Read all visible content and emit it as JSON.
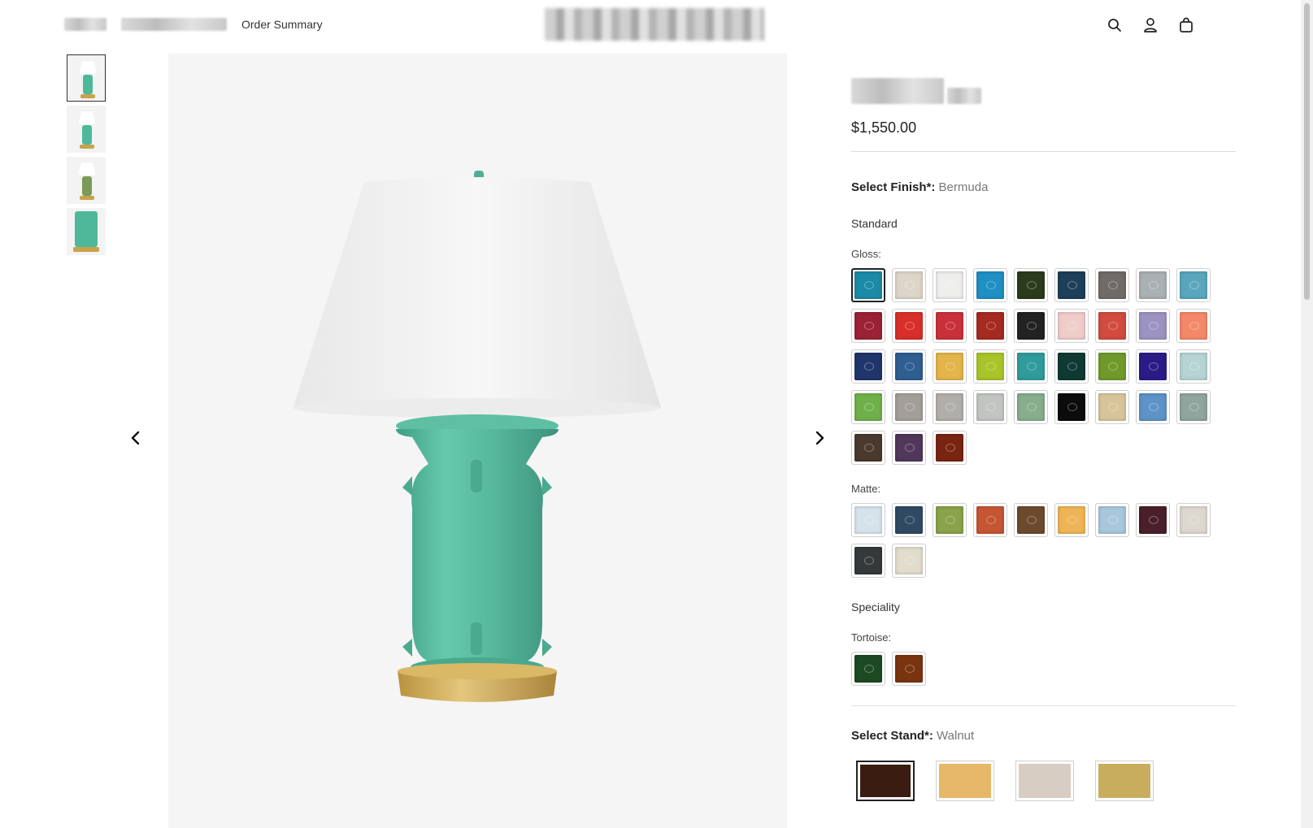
{
  "header": {
    "breadcrumb_current": "Order Summary",
    "icons": [
      "search-icon",
      "account-icon",
      "bag-icon"
    ]
  },
  "gallery": {
    "thumbnails": 4,
    "prev_icon": "chevron-left-icon",
    "next_icon": "chevron-right-icon"
  },
  "product": {
    "price": "$1,550.00",
    "finish": {
      "label": "Select Finish",
      "required_mark": "*:",
      "selected_value": "Bermuda",
      "standard_title": "Standard",
      "gloss_title": "Gloss:",
      "gloss_colors": [
        "#1b8aa6",
        "#ddd6c8",
        "#eeeeec",
        "#1f8fc4",
        "#2c3b1c",
        "#1d3f5a",
        "#6f6b69",
        "#a9b1b3",
        "#5aa6bd",
        "#9b2233",
        "#d92f2a",
        "#c9313a",
        "#a52a20",
        "#222222",
        "#efcdc8",
        "#d14b3e",
        "#9c93c2",
        "#f4896a",
        "#1f356b",
        "#2f5e91",
        "#e3b54a",
        "#a9c42a",
        "#2f9b9b",
        "#0f3a33",
        "#6f9a2a",
        "#2a1c86",
        "#b5d4d3",
        "#6fb04a",
        "#a29e98",
        "#b1aeaa",
        "#c2c4c2",
        "#87ad8d",
        "#0c0c0c",
        "#d7c49a",
        "#5e93c7",
        "#8fa59d",
        "#4a3a2d",
        "#51375a",
        "#7a2412"
      ],
      "matte_title": "Matte:",
      "matte_colors": [
        "#d5e3ec",
        "#2f4a63",
        "#8aa24a",
        "#c65533",
        "#6b4a2e",
        "#efb455",
        "#a9c7dc",
        "#4a1f2a",
        "#ddd8cf",
        "#343a3b",
        "#e2dccd"
      ],
      "speciality_title": "Speciality",
      "tortoise_title": "Tortoise:",
      "tortoise_colors": [
        "#1d4a22",
        "#7a3410"
      ]
    },
    "stand": {
      "label": "Select Stand",
      "required_mark": "*:",
      "selected_value": "Walnut",
      "colors": [
        "#3a1c10",
        "#e6b867",
        "#d8cdc2",
        "#c9ad5f"
      ]
    }
  }
}
